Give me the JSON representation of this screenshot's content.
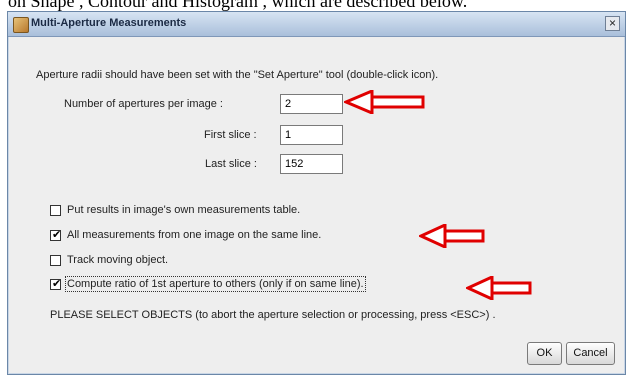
{
  "background": {
    "text": "on Shape , Contour and Histogram , which are described below."
  },
  "dialog": {
    "title": "Multi-Aperture Measurements",
    "close_glyph": "×",
    "instruction": "Aperture radii should have been set with the \"Set Aperture\" tool (double-click icon).",
    "fields": [
      {
        "label": "Number of apertures per image :",
        "value": "2"
      },
      {
        "label": "First slice :",
        "value": "1"
      },
      {
        "label": "Last slice :",
        "value": "152"
      }
    ],
    "checkboxes": [
      {
        "label": "Put results in image's own measurements table.",
        "checked": false
      },
      {
        "label": "All measurements from one image on the same line.",
        "checked": true
      },
      {
        "label": "Track moving object.",
        "checked": false
      },
      {
        "label": "Compute ratio of 1st aperture to others (only if on same line).",
        "checked": true
      }
    ],
    "footer": "PLEASE SELECT OBJECTS (to abort the aperture selection or processing, press <ESC>) .",
    "buttons": {
      "ok": "OK",
      "cancel": "Cancel"
    },
    "annotation_color": "#e00000",
    "check_glyph": "✔"
  }
}
